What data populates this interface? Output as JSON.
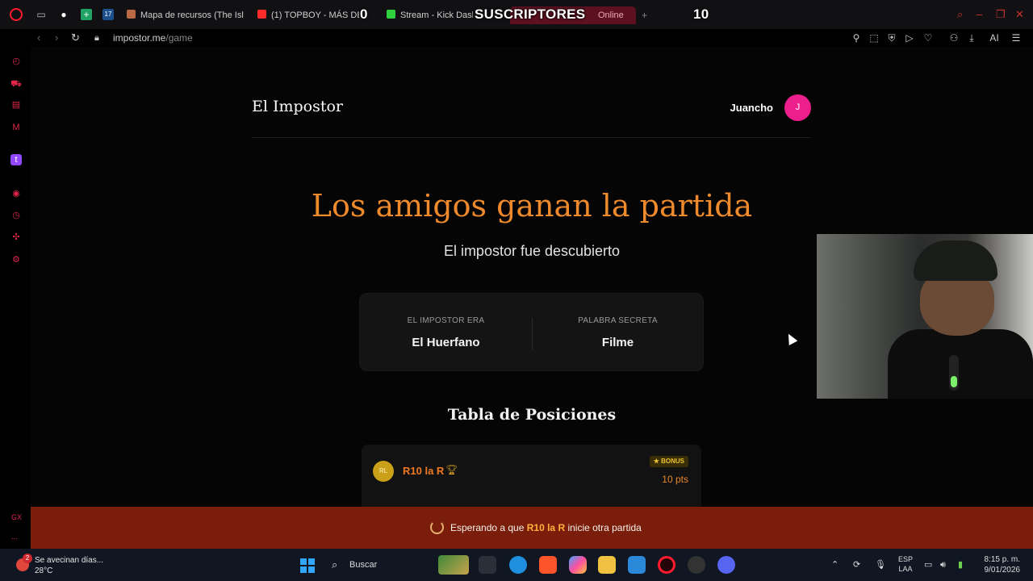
{
  "browser": {
    "tabs": [
      {
        "title": "Mapa de recursos (The Isl",
        "color": "#b96a44"
      },
      {
        "title": "(1) TOPBOY - MÁS DE A",
        "color": "#ff2a2a"
      },
      {
        "title": "Stream - Kick Dashb",
        "color": "#2fd13f"
      },
      {
        "title": "Online",
        "color": "#e22a5c"
      }
    ],
    "new_tab": "+",
    "url_host": "impostor.me",
    "url_path": "/game",
    "ai_label": "AI"
  },
  "stream_overlay": {
    "left_count": "0",
    "label": "SUSCRIPTORES",
    "right_count": "10"
  },
  "app": {
    "brand": "El Impostor",
    "user_name": "Juancho",
    "user_initial": "J"
  },
  "result": {
    "headline": "Los amigos ganan la partida",
    "subhead": "El impostor fue descubierto",
    "impostor_label": "EL IMPOSTOR ERA",
    "impostor_value": "El Huerfano",
    "word_label": "PALABRA SECRETA",
    "word_value": "Filme"
  },
  "leaderboard": {
    "title": "Tabla de Posiciones",
    "rows": [
      {
        "initials": "RL",
        "name": "R10 la R",
        "badge": "★ BONUS",
        "points": "10 pts"
      }
    ]
  },
  "waiting": {
    "before": "Esperando a que ",
    "player": "R10 la R",
    "after": " inicie otra partida"
  },
  "sidebar_bottom": {
    "label": "GX",
    "more": "..."
  },
  "taskbar": {
    "notification_count": "2",
    "weather_text": "Se avecinan días...",
    "temperature": "28°C",
    "search_placeholder": "Buscar",
    "lang_line1": "ESP",
    "lang_line2": "LAA",
    "time": "8:15 p. m.",
    "date": "9/01/2026"
  }
}
